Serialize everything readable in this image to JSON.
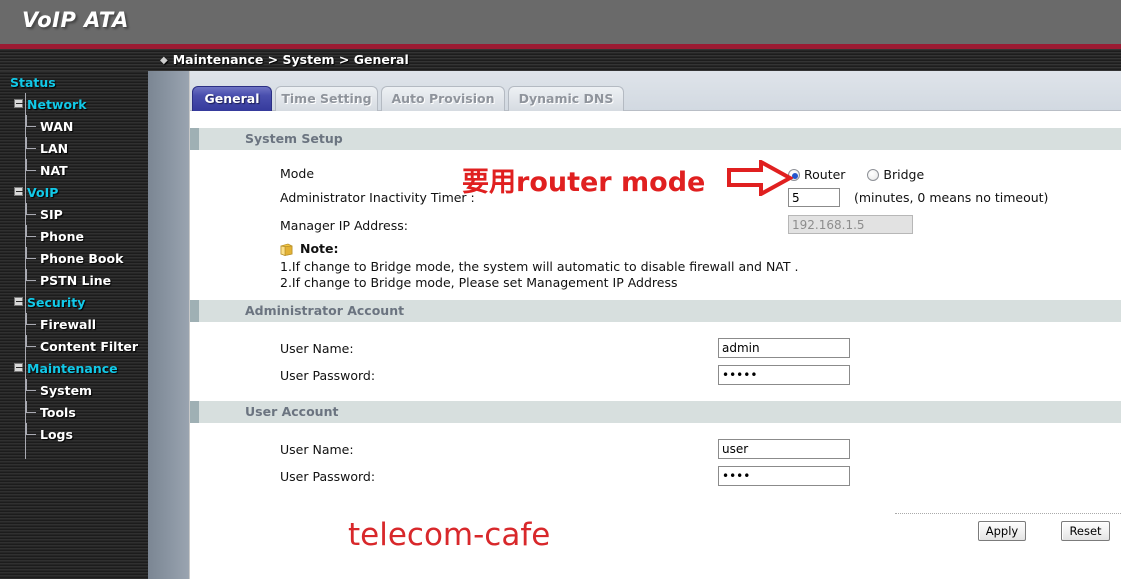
{
  "banner": {
    "logo": "VoIP ATA"
  },
  "breadcrumb": {
    "diamond": "◆",
    "text": "Maintenance > System > General"
  },
  "sidebar": {
    "items": [
      {
        "label": "Status",
        "level": 0,
        "expander": false
      },
      {
        "label": "Network",
        "level": 1,
        "expander": true
      },
      {
        "label": "WAN",
        "level": 2,
        "expander": false
      },
      {
        "label": "LAN",
        "level": 2,
        "expander": false
      },
      {
        "label": "NAT",
        "level": 2,
        "expander": false
      },
      {
        "label": "VoIP",
        "level": 1,
        "expander": true
      },
      {
        "label": "SIP",
        "level": 2,
        "expander": false
      },
      {
        "label": "Phone",
        "level": 2,
        "expander": false
      },
      {
        "label": "Phone Book",
        "level": 2,
        "expander": false
      },
      {
        "label": "PSTN Line",
        "level": 2,
        "expander": false
      },
      {
        "label": "Security",
        "level": 1,
        "expander": true
      },
      {
        "label": "Firewall",
        "level": 2,
        "expander": false
      },
      {
        "label": "Content Filter",
        "level": 2,
        "expander": false
      },
      {
        "label": "Maintenance",
        "level": 1,
        "expander": true
      },
      {
        "label": "System",
        "level": 2,
        "expander": false
      },
      {
        "label": "Tools",
        "level": 2,
        "expander": false
      },
      {
        "label": "Logs",
        "level": 2,
        "expander": false
      }
    ]
  },
  "tabs": [
    {
      "label": "General",
      "active": true
    },
    {
      "label": "Time Setting",
      "active": false
    },
    {
      "label": "Auto Provision",
      "active": false
    },
    {
      "label": "Dynamic DNS",
      "active": false
    }
  ],
  "system_setup": {
    "section_title": "System Setup",
    "mode_label": "Mode",
    "mode_options": [
      {
        "label": "Router",
        "selected": true
      },
      {
        "label": "Bridge",
        "selected": false
      }
    ],
    "inactivity_label": "Administrator Inactivity Timer :",
    "inactivity_value": "5",
    "inactivity_hint": "(minutes, 0 means no timeout)",
    "manager_ip_label": "Manager IP Address:",
    "manager_ip_value": "192.168.1.5",
    "manager_ip_disabled": true,
    "note_title": "Note:",
    "note_lines": [
      "1.If change to Bridge mode, the system will automatic to disable firewall and NAT .",
      "2.If change to Bridge mode, Please set Management IP Address"
    ]
  },
  "admin_account": {
    "section_title": "Administrator Account",
    "username_label": "User Name:",
    "username_value": "admin",
    "password_label": "User Password:",
    "password_value": "•••••"
  },
  "user_account": {
    "section_title": "User Account",
    "username_label": "User Name:",
    "username_value": "user",
    "password_label": "User Password:",
    "password_value": "••••"
  },
  "actions": {
    "apply_label": "Apply",
    "reset_label": "Reset"
  },
  "annotations": {
    "mode_note": "要用router mode",
    "watermark": "telecom-cafe",
    "arrow_icon": "right-arrow-annotation"
  },
  "colors": {
    "banner_gray": "#6a6a6a",
    "accent_red": "#9c1b33",
    "nav_cyan": "#12c9e8",
    "tab_active_blue": "#3b40a0",
    "section_band": "#d7dfde",
    "annotation_red": "#e02020",
    "watermark_red": "#d8282b"
  }
}
